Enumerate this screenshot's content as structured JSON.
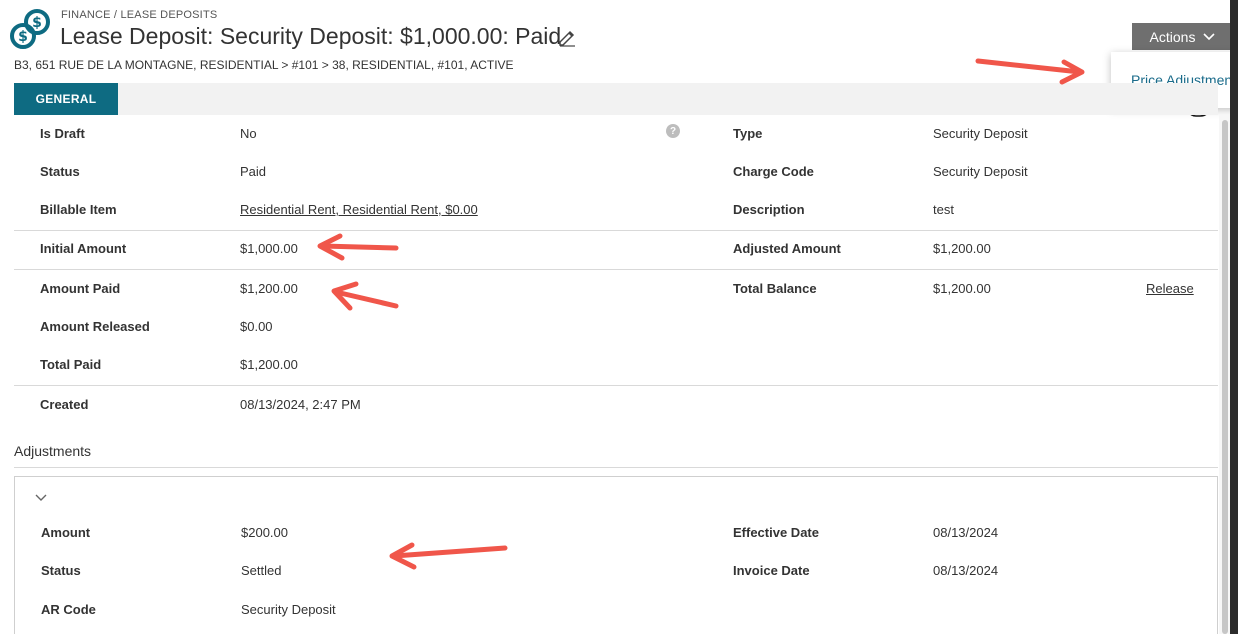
{
  "header": {
    "breadcrumb": "FINANCE / LEASE DEPOSITS",
    "title": "Lease Deposit: Security Deposit: $1,000.00: Paid",
    "subpath": "B3, 651 RUE DE LA MONTAGNE, RESIDENTIAL > #101 > 38, RESIDENTIAL, #101, ACTIVE",
    "icons": {
      "logo": "dollar-coins-logo-icon",
      "edit": "pencil-icon"
    }
  },
  "actions": {
    "label": "Actions",
    "menu": [
      {
        "label": "Price Adjustment"
      }
    ]
  },
  "tabs": [
    {
      "label": "GENERAL",
      "active": true
    }
  ],
  "general": {
    "is_draft": {
      "label": "Is Draft",
      "value": "No"
    },
    "status": {
      "label": "Status",
      "value": "Paid"
    },
    "billable_item": {
      "label": "Billable Item",
      "value": "Residential Rent, Residential Rent, $0.00"
    },
    "initial_amount": {
      "label": "Initial Amount",
      "value": "$1,000.00"
    },
    "amount_paid": {
      "label": "Amount Paid",
      "value": "$1,200.00"
    },
    "amount_released": {
      "label": "Amount Released",
      "value": "$0.00"
    },
    "total_paid": {
      "label": "Total Paid",
      "value": "$1,200.00"
    },
    "created": {
      "label": "Created",
      "value": "08/13/2024, 2:47 PM"
    },
    "type": {
      "label": "Type",
      "value": "Security Deposit"
    },
    "charge_code": {
      "label": "Charge Code",
      "value": "Security Deposit"
    },
    "description": {
      "label": "Description",
      "value": "test"
    },
    "adjusted_amount": {
      "label": "Adjusted Amount",
      "value": "$1,200.00"
    },
    "total_balance": {
      "label": "Total Balance",
      "value": "$1,200.00"
    },
    "release_link": "Release",
    "help_glyph": "?"
  },
  "adjustments": {
    "title": "Adjustments",
    "amount": {
      "label": "Amount",
      "value": "$200.00"
    },
    "status": {
      "label": "Status",
      "value": "Settled"
    },
    "ar_code": {
      "label": "AR Code",
      "value": "Security Deposit"
    },
    "effective_date": {
      "label": "Effective Date",
      "value": "08/13/2024"
    },
    "invoice_date": {
      "label": "Invoice Date",
      "value": "08/13/2024"
    }
  },
  "colors": {
    "tab_active": "#0e6b82",
    "actions_button": "#6f6f6f",
    "menu_link": "#1a6b8a",
    "annotation_arrow": "#f0564a"
  }
}
